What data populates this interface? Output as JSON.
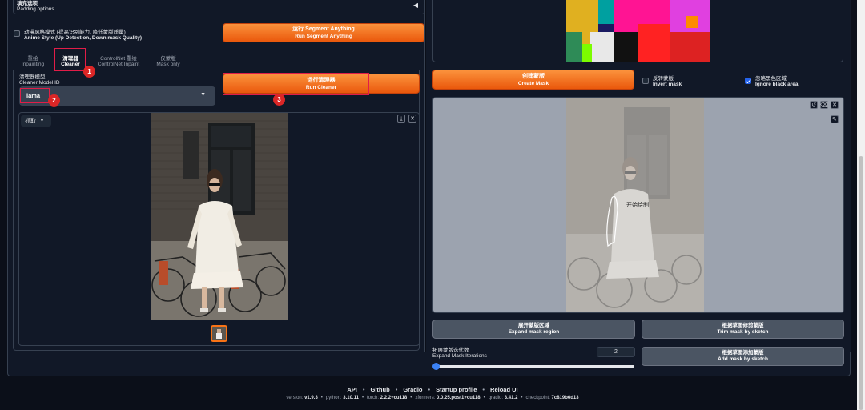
{
  "padding_options": {
    "label_cn": "填充选项",
    "label_en": "Padding options"
  },
  "anime_style": {
    "label_cn": "动漫风格模式 (提高识别能力, 降低蒙版质量)",
    "label_en": "Anime Style (Up Detection, Down mask Quality)",
    "checked": false
  },
  "run_segment": {
    "cn": "运行 Segment Anything",
    "en": "Run Segment Anything"
  },
  "tabs": [
    {
      "cn": "重绘",
      "en": "Inpainting"
    },
    {
      "cn": "清理器",
      "en": "Cleaner"
    },
    {
      "cn": "ControlNet 重绘",
      "en": "ControlNet Inpaint"
    },
    {
      "cn": "仅蒙版",
      "en": "Mask only"
    }
  ],
  "cleaner_model": {
    "label_cn": "清理器模型",
    "label_en": "Cleaner Model ID",
    "value": "lama"
  },
  "run_cleaner": {
    "cn": "运行清理器",
    "en": "Run Cleaner"
  },
  "image_tool": {
    "label": "抓取"
  },
  "annotations": [
    "1",
    "2",
    "3"
  ],
  "create_mask": {
    "cn": "创建蒙版",
    "en": "Create Mask"
  },
  "invert_mask": {
    "cn": "反转蒙版",
    "en": "Invert mask",
    "checked": false
  },
  "ignore_black": {
    "cn": "忽略黑色区域",
    "en": "Ignore black area",
    "checked": true
  },
  "sketch_hint": "开始绘制",
  "expand_mask_region": {
    "cn": "展开蒙版区域",
    "en": "Expand mask region"
  },
  "trim_mask": {
    "cn": "根据草图修剪蒙版",
    "en": "Trim mask by sketch"
  },
  "add_mask": {
    "cn": "根据草图添加蒙版",
    "en": "Add mask by sketch"
  },
  "expand_iterations": {
    "label_cn": "拓展蒙版迭代数",
    "label_en": "Expand Mask Iterations",
    "value": "2",
    "fraction": 0.0
  },
  "footer": {
    "links": [
      "API",
      "Github",
      "Gradio",
      "Startup profile",
      "Reload UI"
    ],
    "versions": [
      {
        "k": "version: ",
        "v": "v1.9.3"
      },
      {
        "k": "python: ",
        "v": "3.10.11"
      },
      {
        "k": "torch: ",
        "v": "2.2.2+cu118"
      },
      {
        "k": "xformers: ",
        "v": "0.0.25.post1+cu118"
      },
      {
        "k": "gradio: ",
        "v": "3.41.2"
      },
      {
        "k": "checkpoint: ",
        "v": "7c819b6d13"
      }
    ]
  },
  "colors": {
    "accent": "#ea580c",
    "annotation": "#e11d48",
    "checkbox_on": "#2563eb"
  }
}
